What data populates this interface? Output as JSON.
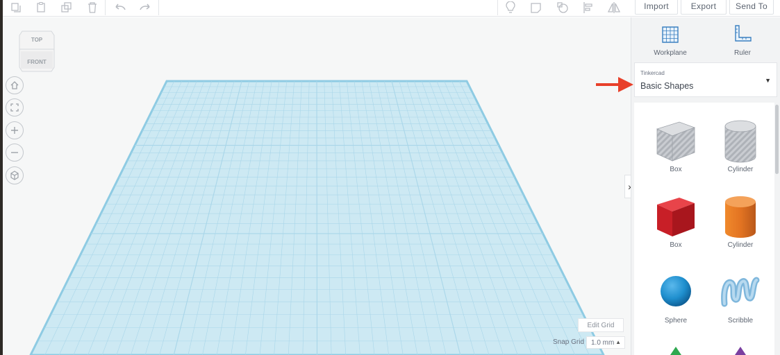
{
  "toolbar": {
    "import_label": "Import",
    "export_label": "Export",
    "send_to_label": "Send To"
  },
  "viewcube": {
    "top_label": "TOP",
    "front_label": "FRONT"
  },
  "viewport": {
    "edit_grid_label": "Edit Grid",
    "snap_grid_label": "Snap Grid",
    "snap_grid_value": "1.0 mm"
  },
  "panel": {
    "workplane_label": "Workplane",
    "ruler_label": "Ruler",
    "category_library": "Tinkercad",
    "category_value": "Basic Shapes",
    "shapes": [
      {
        "label": "Box",
        "icon": "box-hole-icon",
        "color": "#b8bcc2"
      },
      {
        "label": "Cylinder",
        "icon": "cylinder-hole-icon",
        "color": "#b8bcc2"
      },
      {
        "label": "Box",
        "icon": "box-icon",
        "color": "#d4242b"
      },
      {
        "label": "Cylinder",
        "icon": "cylinder-icon",
        "color": "#e57722"
      },
      {
        "label": "Sphere",
        "icon": "sphere-icon",
        "color": "#1f8fce"
      },
      {
        "label": "Scribble",
        "icon": "scribble-icon",
        "color": "#9cc8e3"
      }
    ]
  },
  "colors": {
    "accent_arrow": "#e8402a",
    "grid_fill": "#cde9f3",
    "grid_line": "#a9d6e9"
  }
}
